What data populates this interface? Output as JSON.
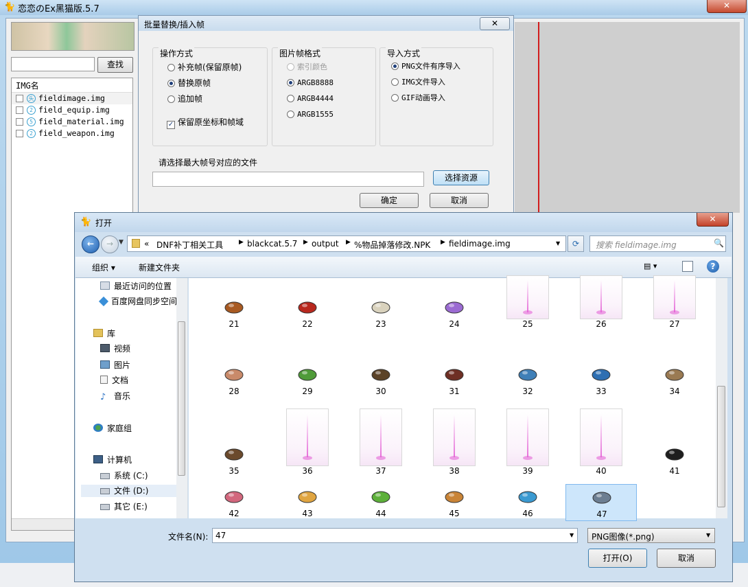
{
  "app": {
    "title": "恋恋のEx黑猫版.5.7",
    "search_button": "查找",
    "list_header": "IMG名",
    "img_files": [
      {
        "badge": "头",
        "name": "fieldimage.img"
      },
      {
        "badge": "2",
        "name": "field_equip.img"
      },
      {
        "badge": "5",
        "name": "field_material.img"
      },
      {
        "badge": "2",
        "name": "field_weapon.img"
      }
    ]
  },
  "batch_dialog": {
    "title": "批量替换/插入帧",
    "close": "✕",
    "operation": {
      "title": "操作方式",
      "options": [
        "补充帧(保留原帧)",
        "替换原帧",
        "追加帧"
      ],
      "selected": 1,
      "keep_coords": "保留原坐标和帧域",
      "keep_coords_checked": true
    },
    "frame_format": {
      "title": "图片帧格式",
      "options": [
        "索引颜色",
        "ARGB8888",
        "ARGB4444",
        "ARGB1555"
      ],
      "selected": 1
    },
    "import_mode": {
      "title": "导入方式",
      "options": [
        "PNG文件有序导入",
        "IMG文件导入",
        "GIF动画导入"
      ],
      "selected": 0
    },
    "file_prompt": "请选择最大帧号对应的文件",
    "file_path": "",
    "choose_button": "选择资源",
    "ok_button": "确定",
    "cancel_button": "取消"
  },
  "open_dialog": {
    "title": "打开",
    "breadcrumb": [
      "«",
      "DNF补丁相关工具",
      "blackcat.5.7",
      "output",
      "%物品掉落修改.NPK",
      "fieldimage.img"
    ],
    "search_placeholder": "搜索 fieldimage.img",
    "toolbar": {
      "organize": "组织 ▾",
      "new_folder": "新建文件夹"
    },
    "nav": {
      "recent": "最近访问的位置",
      "baidu": "百度网盘同步空间",
      "library": "库",
      "videos": "视频",
      "pictures": "图片",
      "documents": "文档",
      "music": "音乐",
      "homegroup": "家庭组",
      "computer": "计算机",
      "drive_c": "系统 (C:)",
      "drive_d": "文件 (D:)",
      "drive_e": "其它 (E:)"
    },
    "files": [
      {
        "label": "21",
        "kind": "sprite",
        "color": "#a85a22",
        "icon": "horn-icon"
      },
      {
        "label": "22",
        "kind": "sprite",
        "color": "#b8281e",
        "icon": "orb-icon"
      },
      {
        "label": "23",
        "kind": "sprite",
        "color": "#d9d2bd",
        "icon": "bone-icon"
      },
      {
        "label": "24",
        "kind": "sprite",
        "color": "#9b6bd2",
        "icon": "crystal-icon"
      },
      {
        "label": "25",
        "kind": "beam"
      },
      {
        "label": "26",
        "kind": "beam"
      },
      {
        "label": "27",
        "kind": "beam"
      },
      {
        "label": "28",
        "kind": "sprite",
        "color": "#c98a6a",
        "icon": "scroll-icon"
      },
      {
        "label": "29",
        "kind": "sprite",
        "color": "#4f9b39",
        "icon": "leaf-icon"
      },
      {
        "label": "30",
        "kind": "sprite",
        "color": "#5b4328",
        "icon": "chest-icon"
      },
      {
        "label": "31",
        "kind": "sprite",
        "color": "#6e2f24",
        "icon": "book-icon"
      },
      {
        "label": "32",
        "kind": "sprite",
        "color": "#3f7fb7",
        "icon": "beast-icon"
      },
      {
        "label": "33",
        "kind": "sprite",
        "color": "#2e6fb2",
        "icon": "statue-icon"
      },
      {
        "label": "34",
        "kind": "sprite",
        "color": "#9a7a52",
        "icon": "sack-icon"
      },
      {
        "label": "35",
        "kind": "sprite",
        "color": "#6b4a2c",
        "icon": "stick-icon"
      },
      {
        "label": "36",
        "kind": "beam"
      },
      {
        "label": "37",
        "kind": "beam"
      },
      {
        "label": "38",
        "kind": "beam"
      },
      {
        "label": "39",
        "kind": "beam"
      },
      {
        "label": "40",
        "kind": "beam"
      },
      {
        "label": "41",
        "kind": "sprite",
        "color": "#1e1e1e",
        "icon": "bomb-icon"
      },
      {
        "label": "42",
        "kind": "sprite",
        "color": "#d2677d",
        "icon": "meat-icon"
      },
      {
        "label": "43",
        "kind": "sprite",
        "color": "#e0a541",
        "icon": "ring-icon"
      },
      {
        "label": "44",
        "kind": "sprite",
        "color": "#5db03a",
        "icon": "capsule-icon"
      },
      {
        "label": "45",
        "kind": "sprite",
        "color": "#c98437",
        "icon": "flower-icon"
      },
      {
        "label": "46",
        "kind": "sprite",
        "color": "#3b9ad1",
        "icon": "hammer-icon"
      },
      {
        "label": "47",
        "kind": "sprite",
        "color": "#6c7e92",
        "icon": "stone-icon",
        "selected": true
      }
    ],
    "filename_label": "文件名(N):",
    "filename_value": "47",
    "filetype": "PNG图像(*.png)",
    "open_button": "打开(O)",
    "cancel_button": "取消"
  }
}
